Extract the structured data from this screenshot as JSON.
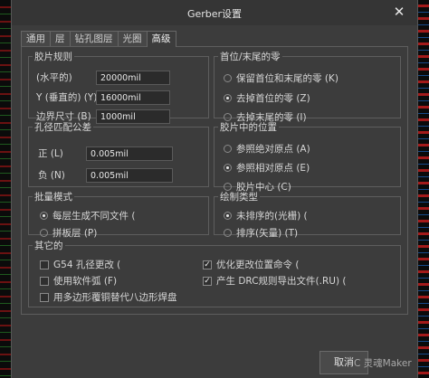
{
  "window": {
    "title": "Gerber设置",
    "close_glyph": "✕"
  },
  "tabs": [
    {
      "label": "通用",
      "active": false
    },
    {
      "label": "层",
      "active": false
    },
    {
      "label": "钻孔图层",
      "active": false
    },
    {
      "label": "光圈",
      "active": false
    },
    {
      "label": "高级",
      "active": true
    }
  ],
  "film_rules": {
    "legend": "胶片规则",
    "x_label": "(水平的)",
    "x_value": "20000mil",
    "y_label": "Y (垂直的) (Y)",
    "y_value": "16000mil",
    "border_label": "边界尺寸 (B)",
    "border_value": "1000mil"
  },
  "leading_zeros": {
    "legend": "首位/末尾的零",
    "options": [
      {
        "label": "保留首位和末尾的零 (K)",
        "selected": false
      },
      {
        "label": "去掉首位的零 (Z)",
        "selected": true
      },
      {
        "label": "去掉末尾的零 (I)",
        "selected": false
      }
    ]
  },
  "aperture_tolerance": {
    "legend": "孔径匹配公差",
    "plus_label": "正 (L)",
    "plus_value": "0.005mil",
    "minus_label": "负 (N)",
    "minus_value": "0.005mil"
  },
  "film_position": {
    "legend": "胶片中的位置",
    "options": [
      {
        "label": "参照绝对原点 (A)",
        "selected": false
      },
      {
        "label": "参照相对原点 (E)",
        "selected": true
      },
      {
        "label": "胶片中心 (C)",
        "selected": false
      }
    ]
  },
  "batch_mode": {
    "legend": "批量模式",
    "options": [
      {
        "label": "每层生成不同文件 (",
        "selected": true
      },
      {
        "label": "拼板层 (P)",
        "selected": false
      }
    ]
  },
  "plot_type": {
    "legend": "绘制类型",
    "options": [
      {
        "label": "未排序的(光栅) (",
        "selected": true
      },
      {
        "label": "排序(矢量) (T)",
        "selected": false
      }
    ]
  },
  "other": {
    "legend": "其它的",
    "left": [
      {
        "label": "G54 孔径更改 (",
        "checked": false
      },
      {
        "label": "使用软件弧 (F)",
        "checked": false
      },
      {
        "label": "用多边形覆铜替代八边形焊盘",
        "checked": false
      }
    ],
    "right": [
      {
        "label": "优化更改位置命令 (",
        "checked": true
      },
      {
        "label": "产生 DRC规则导出文件(.RU) (",
        "checked": true
      }
    ]
  },
  "buttons": {
    "cancel_label": "取消"
  },
  "watermark": "C 灵魂Maker"
}
